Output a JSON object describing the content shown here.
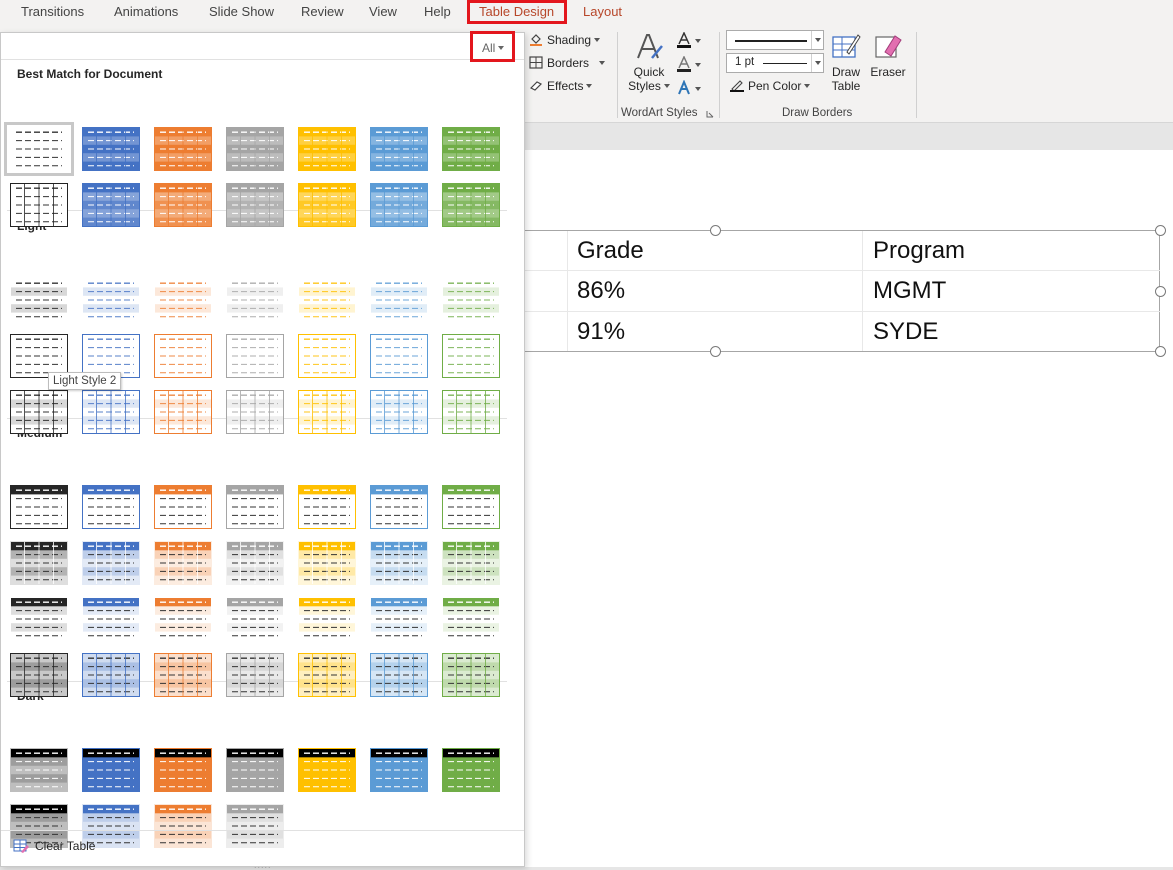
{
  "ribbon_tabs": [
    {
      "label": "Transitions"
    },
    {
      "label": "Animations"
    },
    {
      "label": "Slide Show"
    },
    {
      "label": "Review"
    },
    {
      "label": "View"
    },
    {
      "label": "Help"
    },
    {
      "label": "Table Design"
    },
    {
      "label": "Layout"
    }
  ],
  "ribbon": {
    "shading_label": "Shading",
    "borders_label": "Borders",
    "effects_label": "Effects",
    "quick_styles_line1": "Quick",
    "quick_styles_line2": "Styles",
    "wordart_group_label": "WordArt Styles",
    "pen_weight_value": "1 pt",
    "pen_color_label": "Pen Color",
    "draw_table_line1": "Draw",
    "draw_table_line2": "Table",
    "eraser_label": "Eraser",
    "draw_borders_group_label": "Draw Borders"
  },
  "gallery": {
    "filter_value": "All",
    "sections": [
      {
        "title": "Best Match for Document"
      },
      {
        "title": "Light"
      },
      {
        "title": "Medium"
      },
      {
        "title": "Dark"
      }
    ],
    "tooltip": "Light Style 2",
    "clear_table_label": "Clear Table",
    "theme_colors": [
      "#262626",
      "#4472c4",
      "#ed7d31",
      "#a5a5a5",
      "#ffc000",
      "#5b9bd5",
      "#70ad47"
    ],
    "highlight_color": "#e3161d"
  },
  "table": {
    "headers": [
      "Grade",
      "Program"
    ],
    "rows": [
      [
        "86%",
        "MGMT"
      ],
      [
        "91%",
        "SYDE"
      ]
    ]
  }
}
